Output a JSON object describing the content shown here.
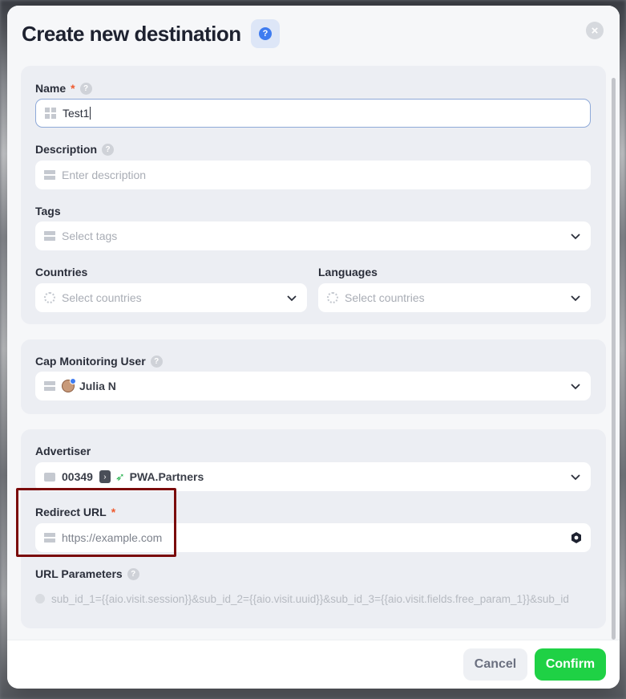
{
  "dialog": {
    "title": "Create new destination",
    "help_icon": "question-circle-icon",
    "close_icon": "close-icon"
  },
  "general": {
    "name": {
      "label": "Name",
      "required_mark": "*",
      "value": "Test1",
      "icon": "grid-icon"
    },
    "description": {
      "label": "Description",
      "placeholder": "Enter description",
      "icon": "rows-icon"
    },
    "tags": {
      "label": "Tags",
      "placeholder": "Select tags",
      "icon": "rows-icon"
    },
    "countries": {
      "label": "Countries",
      "placeholder": "Select countries",
      "icon": "globe-icon"
    },
    "languages": {
      "label": "Languages",
      "placeholder": "Select countries",
      "icon": "globe-icon"
    }
  },
  "monitoring": {
    "cap_user": {
      "label": "Cap Monitoring User",
      "value": "Julia N"
    }
  },
  "advertiser_section": {
    "advertiser": {
      "label": "Advertiser",
      "id": "00349",
      "name": "PWA.Partners"
    },
    "redirect_url": {
      "label": "Redirect URL",
      "required_mark": "*",
      "placeholder": "https://example.com"
    },
    "url_parameters": {
      "label": "URL Parameters",
      "value": "sub_id_1={{aio.visit.session}}&sub_id_2={{aio.visit.uuid}}&sub_id_3={{aio.visit.fields.free_param_1}}&sub_id"
    }
  },
  "footer": {
    "cancel_label": "Cancel",
    "confirm_label": "Confirm"
  },
  "colors": {
    "accent_green": "#1fd145",
    "required_red": "#ef5a2e",
    "help_blue": "#3f7cf0",
    "highlight_border": "#7a0a0a"
  }
}
